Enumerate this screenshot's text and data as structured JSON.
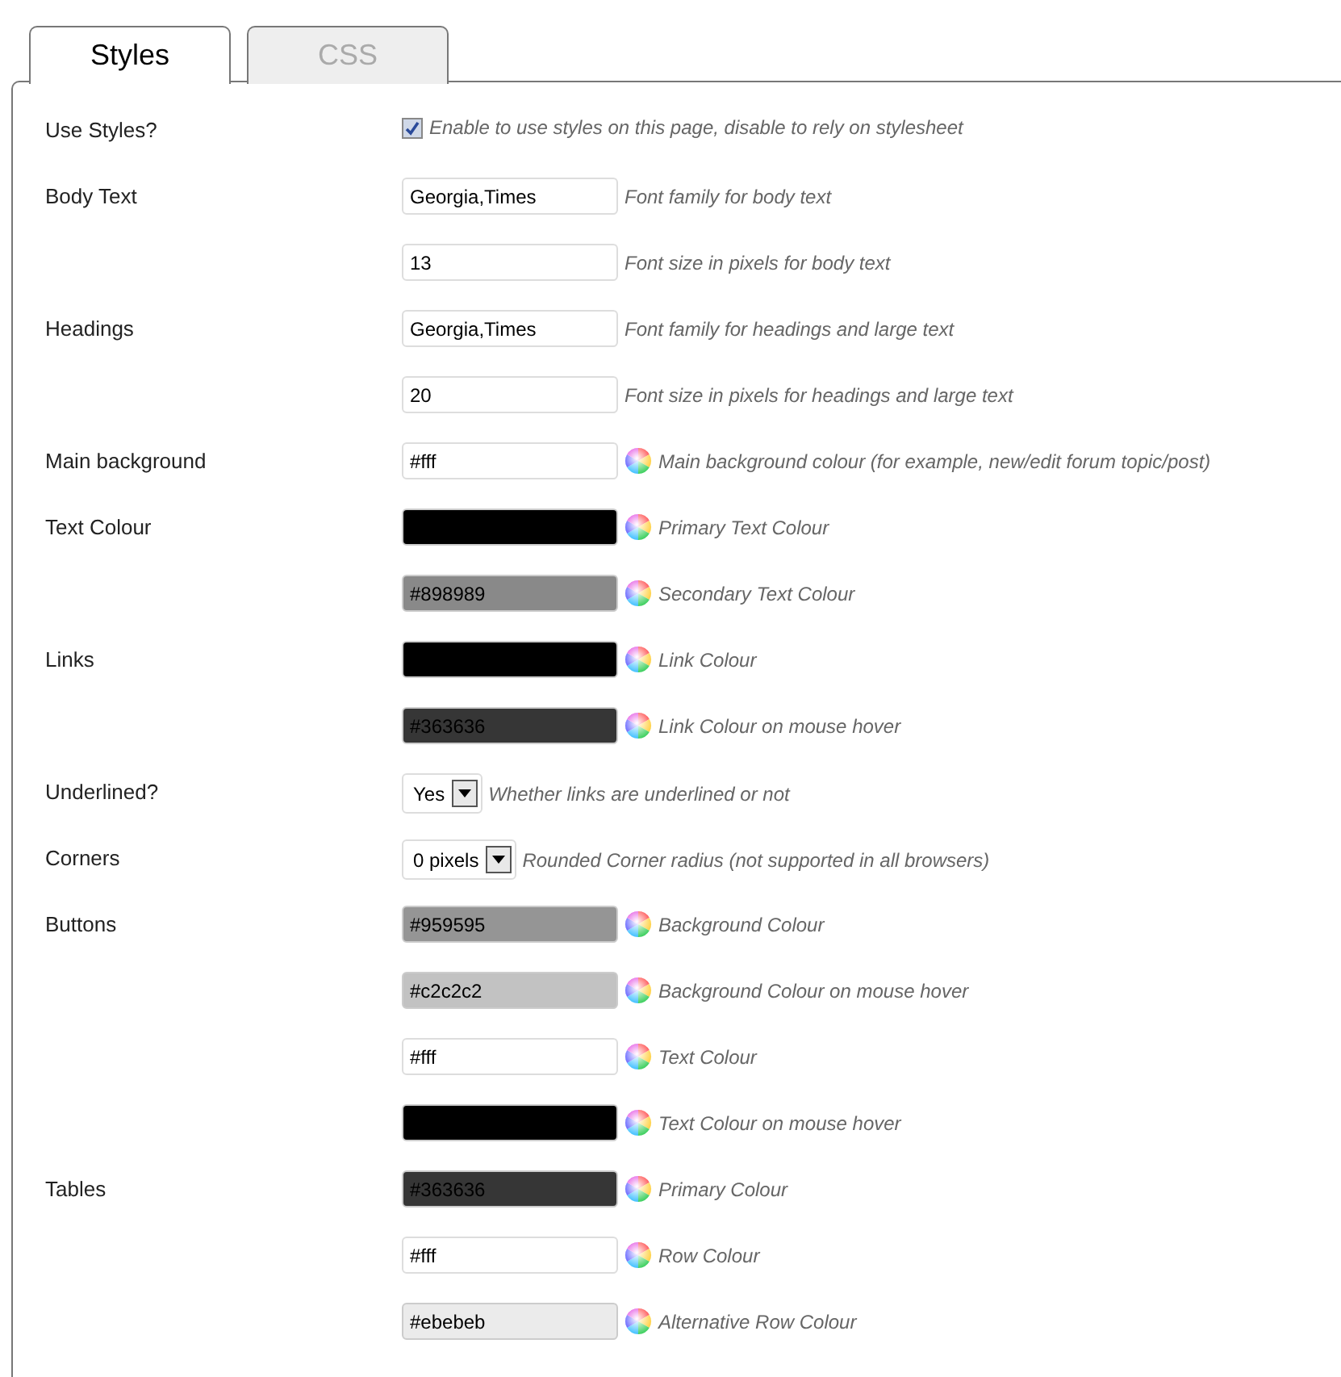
{
  "tabs": [
    {
      "label": "Styles",
      "selected": true
    },
    {
      "label": "CSS",
      "selected": false
    }
  ],
  "rows": [
    {
      "label": "Use Styles?",
      "kind": "checkbox",
      "checked": true,
      "hint": "Enable to use styles on this page, disable to rely on stylesheet"
    },
    {
      "label": "Body Text",
      "kind": "text",
      "value": "Georgia,Times",
      "hint": "Font family for body text"
    },
    {
      "kind": "text",
      "value": "13",
      "hint": "Font size in pixels for body text"
    },
    {
      "label": "Headings",
      "kind": "text",
      "value": "Georgia,Times",
      "hint": "Font family for headings and large text"
    },
    {
      "kind": "text",
      "value": "20",
      "hint": "Font size in pixels for headings and large text"
    },
    {
      "label": "Main background",
      "kind": "color",
      "value": "#fff",
      "color": "#ffffff",
      "hint": "Main background colour (for example, new/edit forum topic/post)"
    },
    {
      "label": "Text Colour",
      "kind": "color",
      "color": "#000000",
      "hint": "Primary Text Colour"
    },
    {
      "kind": "color",
      "value": "#898989",
      "color": "#898989",
      "hint": "Secondary Text Colour"
    },
    {
      "label": "Links",
      "kind": "color",
      "color": "#000000",
      "hint": "Link Colour"
    },
    {
      "kind": "color",
      "value": "#363636",
      "color": "#363636",
      "hint": "Link Colour on mouse hover"
    },
    {
      "label": "Underlined?",
      "kind": "select",
      "value": "Yes",
      "hint": "Whether links are underlined or not"
    },
    {
      "label": "Corners",
      "kind": "select",
      "value": "0 pixels",
      "hint": "Rounded Corner radius (not supported in all browsers)"
    },
    {
      "label": "Buttons",
      "kind": "color",
      "value": "#959595",
      "color": "#959595",
      "hint": "Background Colour"
    },
    {
      "kind": "color",
      "value": "#c2c2c2",
      "color": "#c2c2c2",
      "hint": "Background Colour on mouse hover"
    },
    {
      "kind": "color",
      "value": "#fff",
      "color": "#ffffff",
      "hint": "Text Colour"
    },
    {
      "kind": "color",
      "color": "#000000",
      "hint": "Text Colour on mouse hover"
    },
    {
      "label": "Tables",
      "kind": "color",
      "value": "#363636",
      "color": "#363636",
      "hint": "Primary Colour"
    },
    {
      "kind": "color",
      "value": "#fff",
      "color": "#ffffff",
      "hint": "Row Colour"
    },
    {
      "kind": "color",
      "value": "#ebebeb",
      "color": "#ebebeb",
      "hint": "Alternative Row Colour"
    }
  ]
}
